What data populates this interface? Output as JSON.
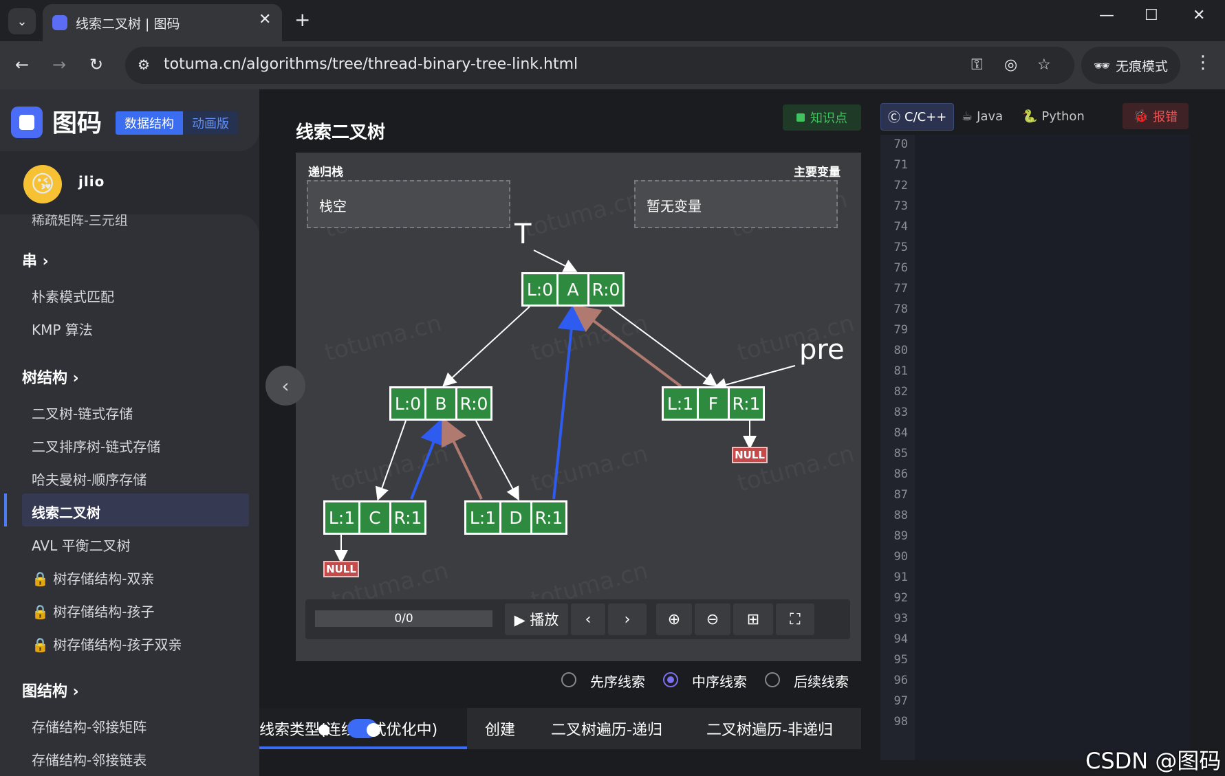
{
  "browser": {
    "tab_title": "线索二叉树 | 图码",
    "url": "totuma.cn/algorithms/tree/thread-binary-tree-link.html",
    "incognito_label": "无痕模式"
  },
  "sidebar": {
    "logo_text": "图码",
    "badge_ds": "数据结构",
    "badge_anim": "动画版",
    "username": "jlio",
    "cut_item": "稀疏矩阵-三元组",
    "sections": [
      {
        "title": "串 ›",
        "items": [
          "朴素模式匹配",
          "KMP 算法"
        ]
      },
      {
        "title": "树结构 ›",
        "items": [
          "二叉树-链式存储",
          "二叉排序树-链式存储",
          "哈夫曼树-顺序存储",
          "线索二叉树",
          "AVL 平衡二叉树",
          "树存储结构-双亲",
          "树存储结构-孩子",
          "树存储结构-孩子双亲"
        ]
      },
      {
        "title": "图结构 ›",
        "items": [
          "存储结构-邻接矩阵",
          "存储结构-邻接链表"
        ]
      }
    ],
    "active_item": "线索二叉树"
  },
  "main": {
    "title": "线索二叉树",
    "knowledge_btn": "知识点",
    "stack_label": "递归栈",
    "stack_value": "栈空",
    "vars_label": "主要变量",
    "vars_value": "暂无变量",
    "watermark": "totuma.cn",
    "pointers": {
      "t": "T",
      "pre": "pre"
    },
    "null_label": "NULL",
    "nodes": {
      "A": {
        "l": "L:0",
        "v": "A",
        "r": "R:0"
      },
      "B": {
        "l": "L:0",
        "v": "B",
        "r": "R:0"
      },
      "F": {
        "l": "L:1",
        "v": "F",
        "r": "R:1"
      },
      "C": {
        "l": "L:1",
        "v": "C",
        "r": "R:1"
      },
      "D": {
        "l": "L:1",
        "v": "D",
        "r": "R:1"
      }
    },
    "progress": "0/0",
    "play_label": "▶ 播放",
    "radios": [
      {
        "label": "先序线索",
        "selected": false
      },
      {
        "label": "中序线索",
        "selected": true
      },
      {
        "label": "后续线索",
        "selected": false
      }
    ],
    "tabs": [
      "线索类型(连线样式优化中)",
      "创建",
      "二叉树遍历-递归",
      "二叉树遍历-非递归"
    ]
  },
  "code_panel": {
    "langs": [
      "C/C++",
      "Java",
      "Python"
    ],
    "report": "报错",
    "line_numbers": [
      "70",
      "71",
      "72",
      "73",
      "74",
      "75",
      "76",
      "77",
      "78",
      "79",
      "80",
      "81",
      "82",
      "83",
      "84",
      "85",
      "86",
      "87",
      "88",
      "89",
      "90",
      "91",
      "92",
      "93",
      "94",
      "95",
      "96",
      "97",
      "98"
    ]
  },
  "csdn_watermark": "CSDN @图码",
  "colors": {
    "node_green": "#2e8a3e",
    "thread_blue": "#2e5bf0",
    "thread_brown": "#b07a70",
    "accent": "#3c6cf5"
  }
}
